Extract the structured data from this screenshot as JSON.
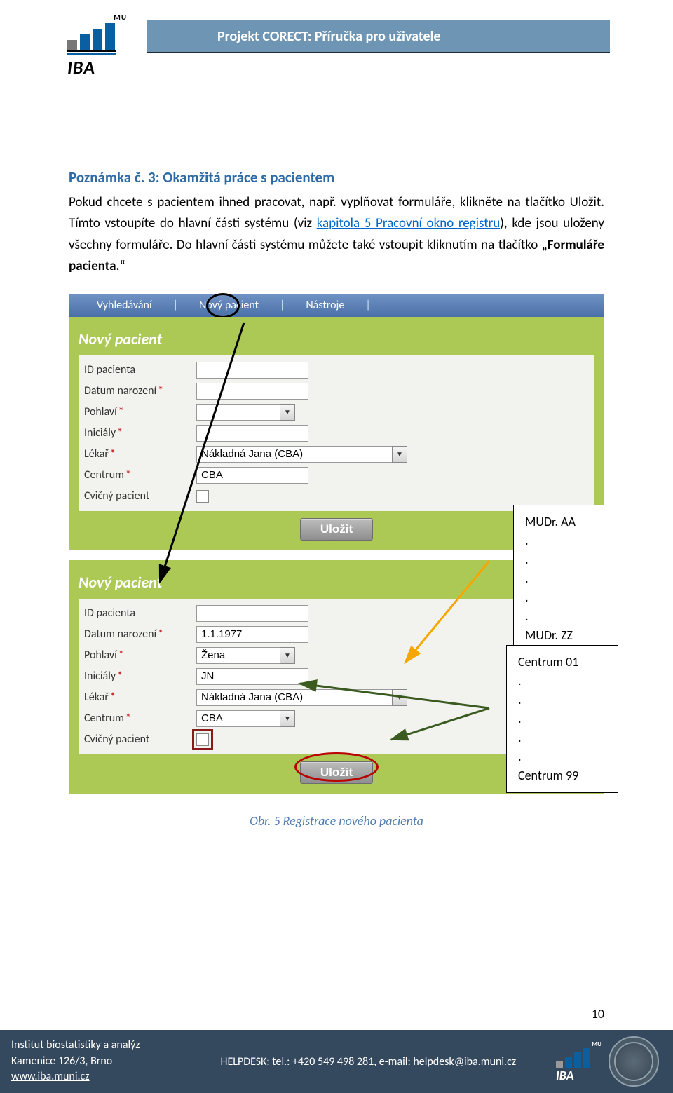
{
  "header": {
    "title": "Projekt CORECT: Příručka pro uživatele",
    "logo_text": "IBA",
    "logo_mu": "MU"
  },
  "note": {
    "title": "Poznámka č. 3: Okamžitá práce s pacientem",
    "p1_a": "Pokud chcete s pacientem ihned pracovat, např. vyplňovat formuláře, klikněte na tlačítko Uložit. Tímto vstoupíte do hlavní části systému (viz ",
    "p1_link": "kapitola 5 Pracovní okno registru",
    "p1_b": "), kde jsou uloženy všechny formuláře. Do hlavní části systému můžete také vstoupit kliknutím na tlačítko „",
    "p1_bold": "Formuláře pacienta.",
    "p1_c": "“"
  },
  "tabs": {
    "t1": "Vyhledávání",
    "t2": "Nový pacient",
    "t3": "Nástroje"
  },
  "form": {
    "panel_title": "Nový pacient",
    "labels": {
      "id": "ID pacienta",
      "dob": "Datum narození",
      "sex": "Pohlaví",
      "initials": "Iniciály",
      "doctor": "Lékař",
      "center": "Centrum",
      "training": "Cvičný pacient"
    },
    "values_top": {
      "id": "",
      "dob": "",
      "sex": "",
      "initials": "",
      "doctor": "Nákladná Jana (CBA)",
      "center": "CBA"
    },
    "values_bottom": {
      "id": "",
      "dob": "1.1.1977",
      "sex": "Žena",
      "initials": "JN",
      "doctor": "Nákladná Jana (CBA)",
      "center": "CBA"
    },
    "save": "Uložit"
  },
  "callout_doctor": {
    "line1": "MUDr. AA",
    "dots": ".\n.\n.\n.\n.",
    "line2": "MUDr. ZZ"
  },
  "callout_center": {
    "line1": "Centrum 01",
    "dots": ".\n.\n.\n.\n.",
    "line2": "Centrum 99"
  },
  "figure_caption": "Obr. 5 Registrace nového pacienta",
  "page_number": "10",
  "footer": {
    "org": "Institut biostatistiky a analýz",
    "addr": "Kamenice 126/3, Brno",
    "web": "www.iba.muni.cz",
    "helpdesk": "HELPDESK: tel.: +420 549 498 281, e-mail: helpdesk@iba.muni.cz"
  }
}
